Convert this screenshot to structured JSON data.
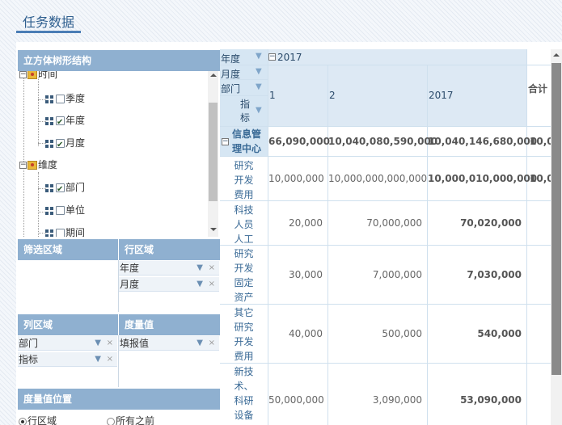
{
  "page": {
    "title": "任务数据"
  },
  "left_panel": {
    "tree_header": "立方体树形结构",
    "tree": [
      {
        "label": "时间",
        "kind": "folder"
      },
      {
        "label": "季度",
        "kind": "leaf",
        "checked": false
      },
      {
        "label": "年度",
        "kind": "leaf",
        "checked": true
      },
      {
        "label": "月度",
        "kind": "leaf",
        "checked": true
      },
      {
        "label": "维度",
        "kind": "folder"
      },
      {
        "label": "部门",
        "kind": "leaf",
        "checked": true
      },
      {
        "label": "单位",
        "kind": "leaf",
        "checked": false
      },
      {
        "label": "期间",
        "kind": "leaf",
        "checked": false
      }
    ],
    "filter_zone": {
      "header": "筛选区域"
    },
    "row_zone": {
      "header": "行区域",
      "items": [
        "年度",
        "月度"
      ]
    },
    "col_zone": {
      "header": "列区域",
      "items": [
        "部门",
        "指标"
      ]
    },
    "measure_zone": {
      "header": "度量值",
      "items": [
        "填报值"
      ]
    },
    "measure_pos": {
      "header": "度量值位置",
      "opt1": "行区域",
      "opt2": "所有之前"
    }
  },
  "pivot": {
    "row_headers": {
      "year": "年度",
      "month": "月度",
      "dept": "部门",
      "metric": "指标"
    },
    "year_value": "2017",
    "col_headers": [
      "1",
      "2",
      "2017",
      "合计"
    ],
    "group_row": {
      "label": "信息管理中心",
      "values": [
        "66,090,000",
        "10,040,080,590,000",
        "10,040,146,680,000",
        "10,0"
      ]
    },
    "rows": [
      {
        "label": "研究开发费用",
        "values": [
          "10,000,000",
          "10,000,000,000,000",
          "10,000,010,000,000",
          "10,0"
        ]
      },
      {
        "label": "科技人员人工",
        "values": [
          "20,000",
          "70,000,000",
          "70,020,000",
          ""
        ]
      },
      {
        "label": "研究开发固定资产",
        "values": [
          "30,000",
          "7,000,000",
          "7,030,000",
          ""
        ]
      },
      {
        "label": "其它研究开发费用",
        "values": [
          "40,000",
          "500,000",
          "540,000",
          ""
        ]
      },
      {
        "label": "新技术、科研设备",
        "values": [
          "50,000,000",
          "3,090,000",
          "53,090,000",
          ""
        ]
      }
    ]
  }
}
